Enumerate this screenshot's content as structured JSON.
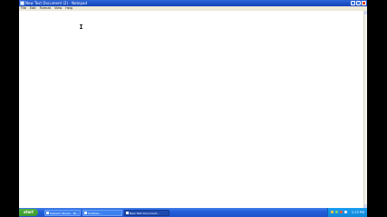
{
  "window": {
    "title": "New Text Document (2) - Notepad",
    "controls": [
      "minimize-icon",
      "maximize-icon",
      "close-icon"
    ]
  },
  "menubar": {
    "items": [
      "File",
      "Edit",
      "Format",
      "View",
      "Help"
    ]
  },
  "editor": {
    "content": ""
  },
  "taskbar": {
    "start_label": "start",
    "tasks": [
      {
        "label": "Kaboom Studio - Mi...",
        "active": false
      },
      {
        "label": "Untitled...",
        "active": false
      },
      {
        "label": "New Text Document...",
        "active": true
      }
    ],
    "clock": "1:13 PM"
  },
  "colors": {
    "titlebar": "#1a4fc4",
    "taskbar": "#245edb",
    "start_button": "#3a9a2c",
    "tray": "#0f86d9"
  }
}
